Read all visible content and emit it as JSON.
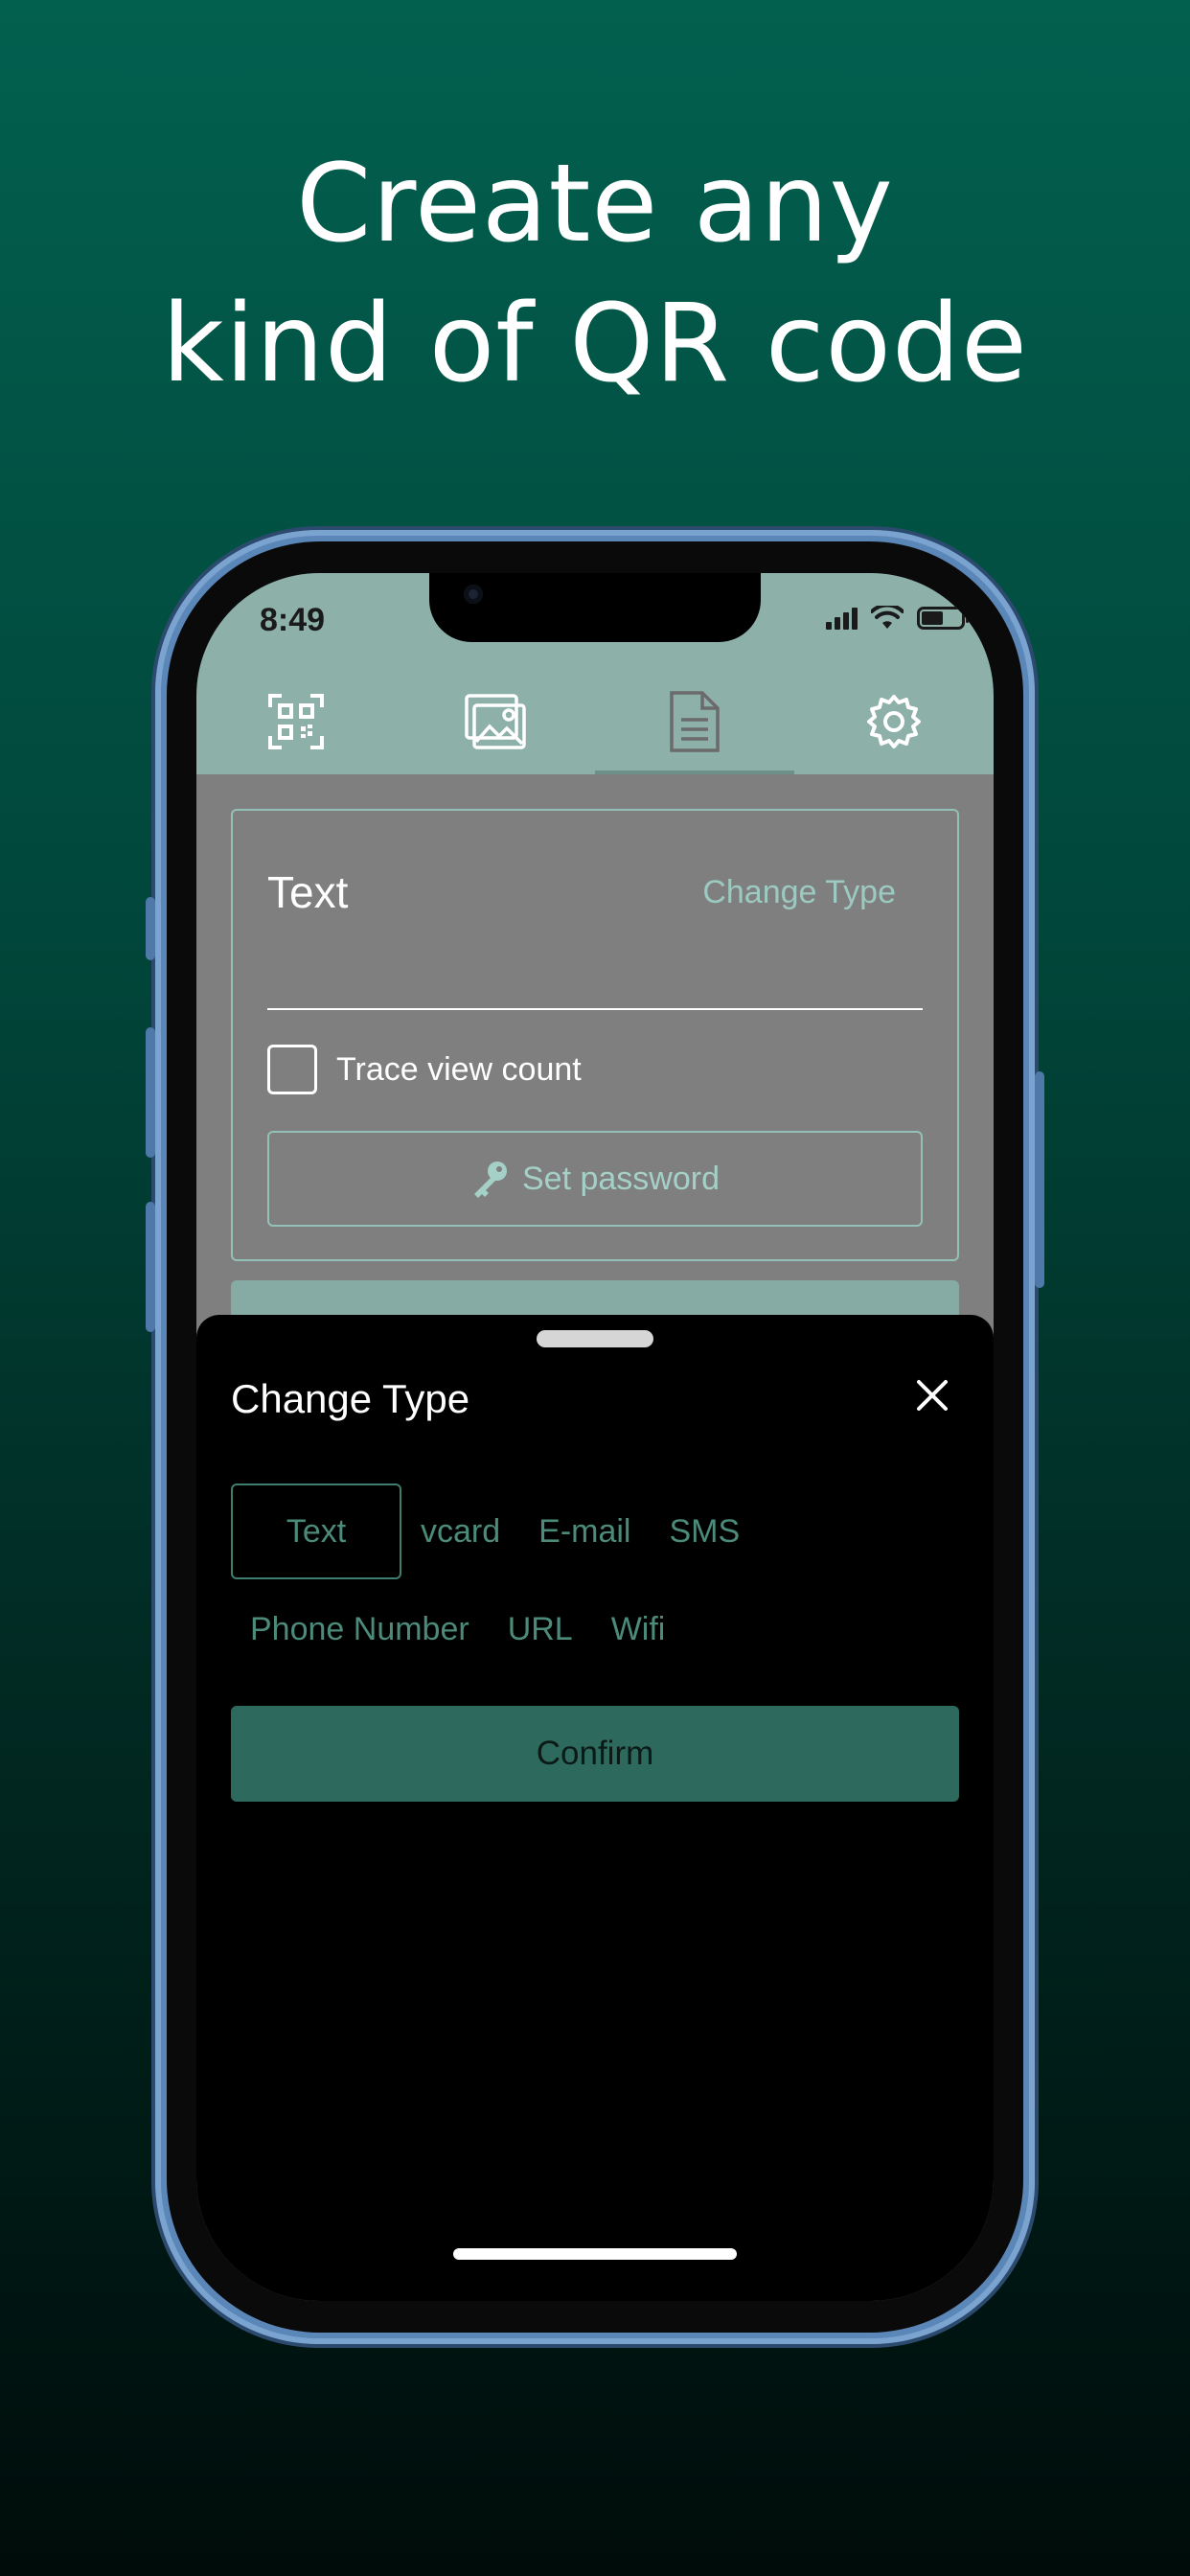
{
  "headline": {
    "line1": "Create any",
    "line2": "kind of QR code"
  },
  "status_bar": {
    "time": "8:49"
  },
  "tabs": [
    {
      "icon": "qr-scan-icon"
    },
    {
      "icon": "image-icon"
    },
    {
      "icon": "document-icon",
      "active": true
    },
    {
      "icon": "gear-icon"
    }
  ],
  "form": {
    "type_title": "Text",
    "change_type_link": "Change Type",
    "trace_label": "Trace view count",
    "set_password_label": "Set password",
    "key_icon": "key-icon"
  },
  "sheet": {
    "title": "Change Type",
    "types_row1": [
      "Text",
      "vcard",
      "E-mail",
      "SMS"
    ],
    "types_row2": [
      "Phone Number",
      "URL",
      "Wifi"
    ],
    "selected_type": "Text",
    "confirm_label": "Confirm"
  },
  "colors": {
    "accent": "#2d6a5d",
    "chip_text": "#4c8a7a",
    "header_bg": "#8db0a9",
    "dim_bg": "#7f7f7f"
  }
}
